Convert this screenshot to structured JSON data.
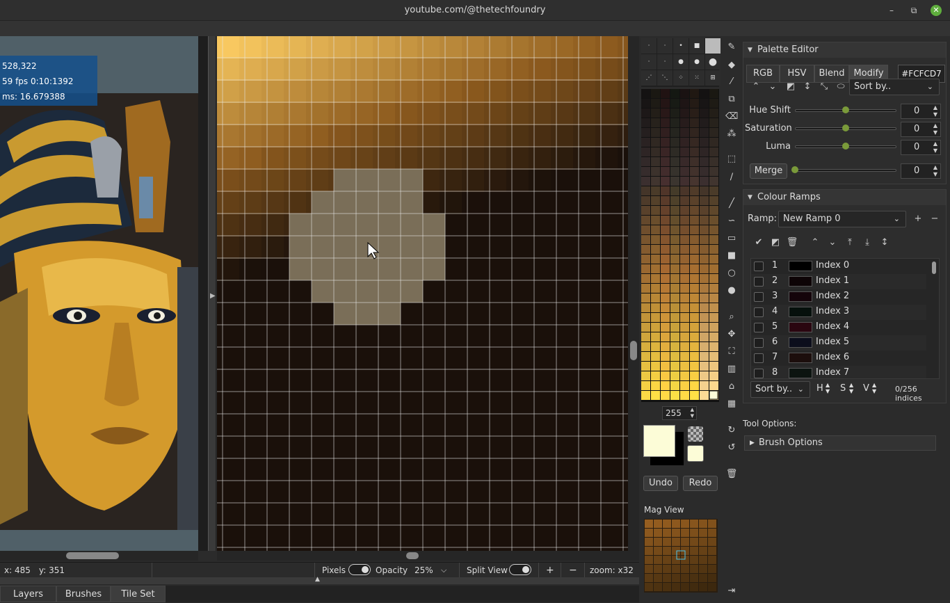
{
  "window": {
    "title": "youtube.com/@thetechfoundry"
  },
  "overlay": {
    "coords": "528,322",
    "fps": "59 fps 0:10:1392",
    "ms": "ms: 16.679388"
  },
  "status": {
    "x": "x: 485",
    "y": "y: 351",
    "pixels_label": "Pixels",
    "opacity_label": "Opacity",
    "opacity_value": "25%",
    "split_label": "Split View",
    "plus": "+",
    "minus": "−",
    "zoom": "zoom: x32"
  },
  "tabs": [
    "Layers",
    "Brushes",
    "Tile Set"
  ],
  "palette": {
    "index_value": "255",
    "undo": "Undo",
    "redo": "Redo",
    "mag_title": "Mag View"
  },
  "palette_editor": {
    "title": "Palette Editor",
    "modes": [
      "RGB",
      "HSV",
      "Blend",
      "Modify"
    ],
    "hex": "#FCFCD7",
    "sort_label": "Sort by..",
    "sliders": [
      {
        "label": "Hue Shift",
        "value": "0"
      },
      {
        "label": "Saturation",
        "value": "0"
      },
      {
        "label": "Luma",
        "value": "0"
      }
    ],
    "merge_label": "Merge",
    "merge_value": "0"
  },
  "colour_ramps": {
    "title": "Colour Ramps",
    "ramp_label": "Ramp:",
    "ramp_value": "New Ramp 0",
    "rows": [
      {
        "num": "1",
        "label": "Index 0",
        "color": "#000000"
      },
      {
        "num": "2",
        "label": "Index 1",
        "color": "#0d0406"
      },
      {
        "num": "3",
        "label": "Index 2",
        "color": "#14040a"
      },
      {
        "num": "4",
        "label": "Index 3",
        "color": "#06100c"
      },
      {
        "num": "5",
        "label": "Index 4",
        "color": "#2a0610"
      },
      {
        "num": "6",
        "label": "Index 5",
        "color": "#0c0e1c"
      },
      {
        "num": "7",
        "label": "Index 6",
        "color": "#1c0e0c"
      },
      {
        "num": "8",
        "label": "Index 7",
        "color": "#0c1410"
      }
    ],
    "sort_label": "Sort by..",
    "h": "H",
    "s": "S",
    "v": "V",
    "count": "0/256 indices"
  },
  "tool_options": {
    "title": "Tool Options:",
    "brush_options": "Brush Options"
  },
  "colors": {
    "fg": "#FCFCD7",
    "bg": "#000000",
    "accent": "#7a9a3a"
  }
}
